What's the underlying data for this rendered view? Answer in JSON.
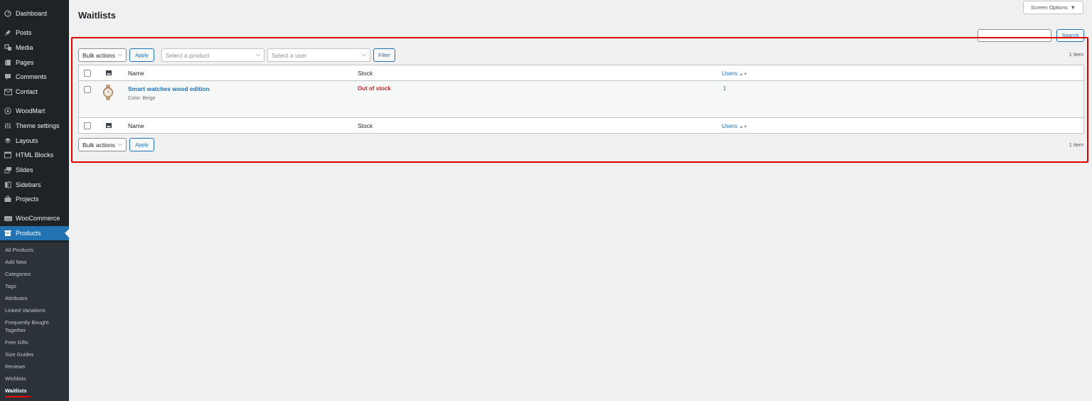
{
  "sidebar": {
    "items": [
      {
        "label": "Dashboard",
        "icon": "dashboard-icon"
      },
      {
        "label": "Posts",
        "icon": "pin-icon"
      },
      {
        "label": "Media",
        "icon": "media-icon"
      },
      {
        "label": "Pages",
        "icon": "pages-icon"
      },
      {
        "label": "Comments",
        "icon": "comment-icon"
      },
      {
        "label": "Contact",
        "icon": "mail-icon"
      },
      {
        "label": "WoodMart",
        "icon": "woodmart-icon"
      },
      {
        "label": "Theme settings",
        "icon": "sliders-icon"
      },
      {
        "label": "Layouts",
        "icon": "layers-icon"
      },
      {
        "label": "HTML Blocks",
        "icon": "html-icon"
      },
      {
        "label": "Slides",
        "icon": "slides-icon"
      },
      {
        "label": "Sidebars",
        "icon": "sidebar-icon"
      },
      {
        "label": "Projects",
        "icon": "briefcase-icon"
      },
      {
        "label": "WooCommerce",
        "icon": "woo-icon"
      },
      {
        "label": "Products",
        "icon": "archive-icon"
      }
    ],
    "submenu": [
      "All Products",
      "Add New",
      "Categories",
      "Tags",
      "Attributes",
      "Linked Variations",
      "Frequently Bought Together",
      "Free Gifts",
      "Size Guides",
      "Reviews",
      "Wishlists",
      "Waitlists"
    ]
  },
  "page": {
    "title": "Waitlists",
    "screen_options": "Screen Options",
    "search_button": "Search"
  },
  "top_controls": {
    "bulk_actions": "Bulk actions",
    "apply": "Apply",
    "product_placeholder": "Select a product",
    "user_placeholder": "Select a user",
    "filter": "Filter",
    "count": "1 item"
  },
  "table": {
    "columns": {
      "name": "Name",
      "stock": "Stock",
      "users": "Users"
    },
    "rows": [
      {
        "product": "Smart watches wood edition",
        "variation": "Color: Beige",
        "stock": "Out of stock",
        "users": "1"
      }
    ]
  },
  "bottom_controls": {
    "bulk_actions": "Bulk actions",
    "apply": "Apply",
    "count": "1 item"
  },
  "colors": {
    "sidebar_bg": "#1d2327",
    "accent": "#2271b1",
    "highlight": "#dd0000",
    "out_of_stock": "#b32d2e"
  }
}
